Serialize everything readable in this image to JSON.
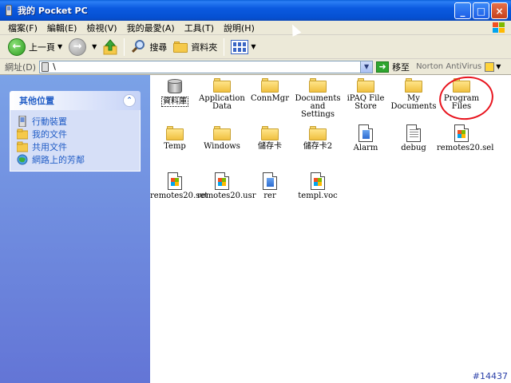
{
  "window": {
    "title": "我的 Pocket PC",
    "buttons": {
      "minimize": "_",
      "maximize": "□",
      "close": "×"
    }
  },
  "menubar": {
    "items": [
      {
        "label": "檔案(F)"
      },
      {
        "label": "編輯(E)"
      },
      {
        "label": "檢視(V)"
      },
      {
        "label": "我的最愛(A)"
      },
      {
        "label": "工具(T)"
      },
      {
        "label": "說明(H)"
      }
    ]
  },
  "toolbar": {
    "back_label": "上一頁",
    "search_label": "搜尋",
    "folders_label": "資料夾"
  },
  "address": {
    "label": "網址(D)",
    "value": "\\",
    "go_label": "移至",
    "norton_label": "Norton AntiVirus"
  },
  "tasks": {
    "header": "其他位置",
    "links": [
      {
        "label": "行動裝置",
        "icon": "device-icon"
      },
      {
        "label": "我的文件",
        "icon": "folder-icon"
      },
      {
        "label": "共用文件",
        "icon": "folder-icon"
      },
      {
        "label": "網路上的芳鄰",
        "icon": "network-icon"
      }
    ]
  },
  "files": [
    {
      "name": "資料庫",
      "type": "database"
    },
    {
      "name": "Application Data",
      "type": "folder"
    },
    {
      "name": "ConnMgr",
      "type": "folder"
    },
    {
      "name": "Documents and Settings",
      "type": "folder"
    },
    {
      "name": "iPAQ File Store",
      "type": "folder"
    },
    {
      "name": "My Documents",
      "type": "folder"
    },
    {
      "name": "Program Files",
      "type": "folder"
    },
    {
      "name": "Temp",
      "type": "folder"
    },
    {
      "name": "Windows",
      "type": "folder"
    },
    {
      "name": "儲存卡",
      "type": "folder"
    },
    {
      "name": "儲存卡2",
      "type": "folder"
    },
    {
      "name": "Alarm",
      "type": "doc-blue"
    },
    {
      "name": "debug",
      "type": "doc-lines"
    },
    {
      "name": "remotes20.sel",
      "type": "doc-win"
    },
    {
      "name": "remotes20.set",
      "type": "doc-win"
    },
    {
      "name": "remotes20.usr",
      "type": "doc-win"
    },
    {
      "name": "rer",
      "type": "doc-blue"
    },
    {
      "name": "templ.voc",
      "type": "doc-win"
    }
  ],
  "watermark": "#14437",
  "colors": {
    "title_blue": "#0550d2",
    "link_blue": "#215dc6",
    "annotation_red": "#e8141e"
  }
}
